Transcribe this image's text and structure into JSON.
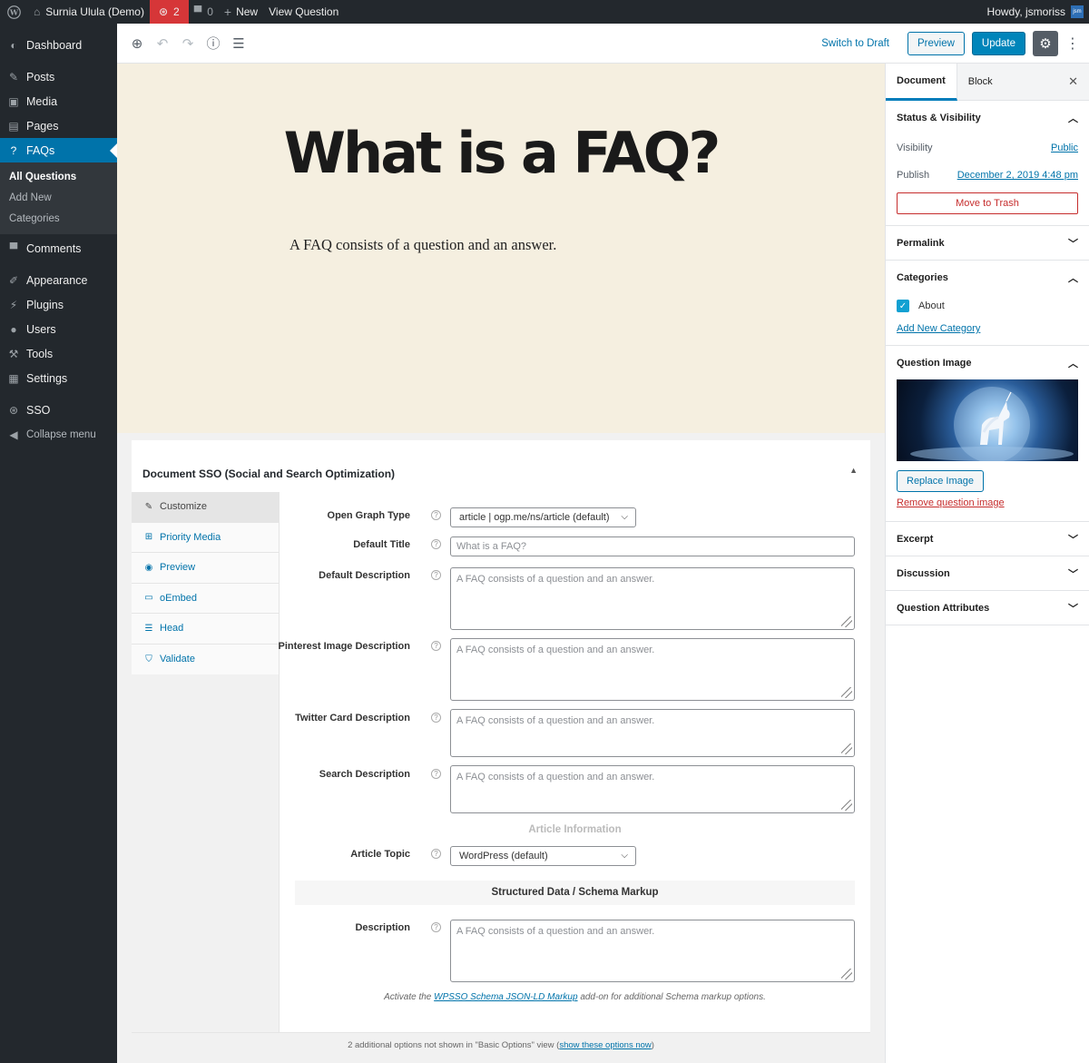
{
  "adminbar": {
    "site_name": "Surnia Ulula (Demo)",
    "updates_count": "2",
    "comments_count": "0",
    "new_label": "New",
    "view_label": "View Question",
    "howdy": "Howdy, jsmoriss",
    "avatar_text": "jsm"
  },
  "sidebar": {
    "items": [
      {
        "label": "Dashboard",
        "icon": "dashboard-icon"
      },
      {
        "label": "Posts",
        "icon": "pin-icon"
      },
      {
        "label": "Media",
        "icon": "media-icon"
      },
      {
        "label": "Pages",
        "icon": "pages-icon"
      },
      {
        "label": "FAQs",
        "icon": "question-icon"
      },
      {
        "label": "Comments",
        "icon": "comment-icon"
      },
      {
        "label": "Appearance",
        "icon": "brush-icon"
      },
      {
        "label": "Plugins",
        "icon": "plug-icon"
      },
      {
        "label": "Users",
        "icon": "user-icon"
      },
      {
        "label": "Tools",
        "icon": "wrench-icon"
      },
      {
        "label": "Settings",
        "icon": "settings-icon"
      },
      {
        "label": "SSO",
        "icon": "sso-icon"
      },
      {
        "label": "Collapse menu",
        "icon": "collapse-icon"
      }
    ],
    "submenu": [
      "All Questions",
      "Add New",
      "Categories"
    ]
  },
  "toolbar": {
    "switch_draft": "Switch to Draft",
    "preview": "Preview",
    "update": "Update"
  },
  "post": {
    "title": "What is a FAQ?",
    "body": "A FAQ consists of a question and an answer."
  },
  "metabox": {
    "title": "Document SSO (Social and Search Optimization)",
    "tabs": [
      "Customize",
      "Priority Media",
      "Preview",
      "oEmbed",
      "Head",
      "Validate"
    ],
    "og_type_label": "Open Graph Type",
    "og_type_value": "article | ogp.me/ns/article (default)",
    "default_title_label": "Default Title",
    "default_title_placeholder": "What is a FAQ?",
    "default_desc_label": "Default Description",
    "pinterest_label": "Pinterest Image Description",
    "twitter_label": "Twitter Card Description",
    "search_label": "Search Description",
    "desc_placeholder": "A FAQ consists of a question and an answer.",
    "article_info_head": "Article Information",
    "article_topic_label": "Article Topic",
    "article_topic_value": "WordPress (default)",
    "schema_head": "Structured Data / Schema Markup",
    "schema_desc_label": "Description",
    "schema_note_pre": "Activate the",
    "schema_note_link": "WPSSO Schema JSON-LD Markup",
    "schema_note_post": "add-on for additional Schema markup options.",
    "footer_pre": "2 additional options not shown in \"Basic Options\" view (",
    "footer_link": "show these options now",
    "footer_post": ")"
  },
  "settings": {
    "tab_document": "Document",
    "tab_block": "Block",
    "status_title": "Status & Visibility",
    "visibility_label": "Visibility",
    "visibility_value": "Public",
    "publish_label": "Publish",
    "publish_value": "December 2, 2019 4:48 pm",
    "trash": "Move to Trash",
    "permalink": "Permalink",
    "categories": "Categories",
    "category_about": "About",
    "add_category": "Add New Category",
    "question_image": "Question Image",
    "replace_image": "Replace Image",
    "remove_image": "Remove question image",
    "excerpt": "Excerpt",
    "discussion": "Discussion",
    "question_attributes": "Question Attributes"
  },
  "colors": {
    "admin_dark": "#23282d",
    "accent": "#0073aa",
    "canvas_bg": "#f5efe0",
    "danger": "#c62d2d"
  }
}
